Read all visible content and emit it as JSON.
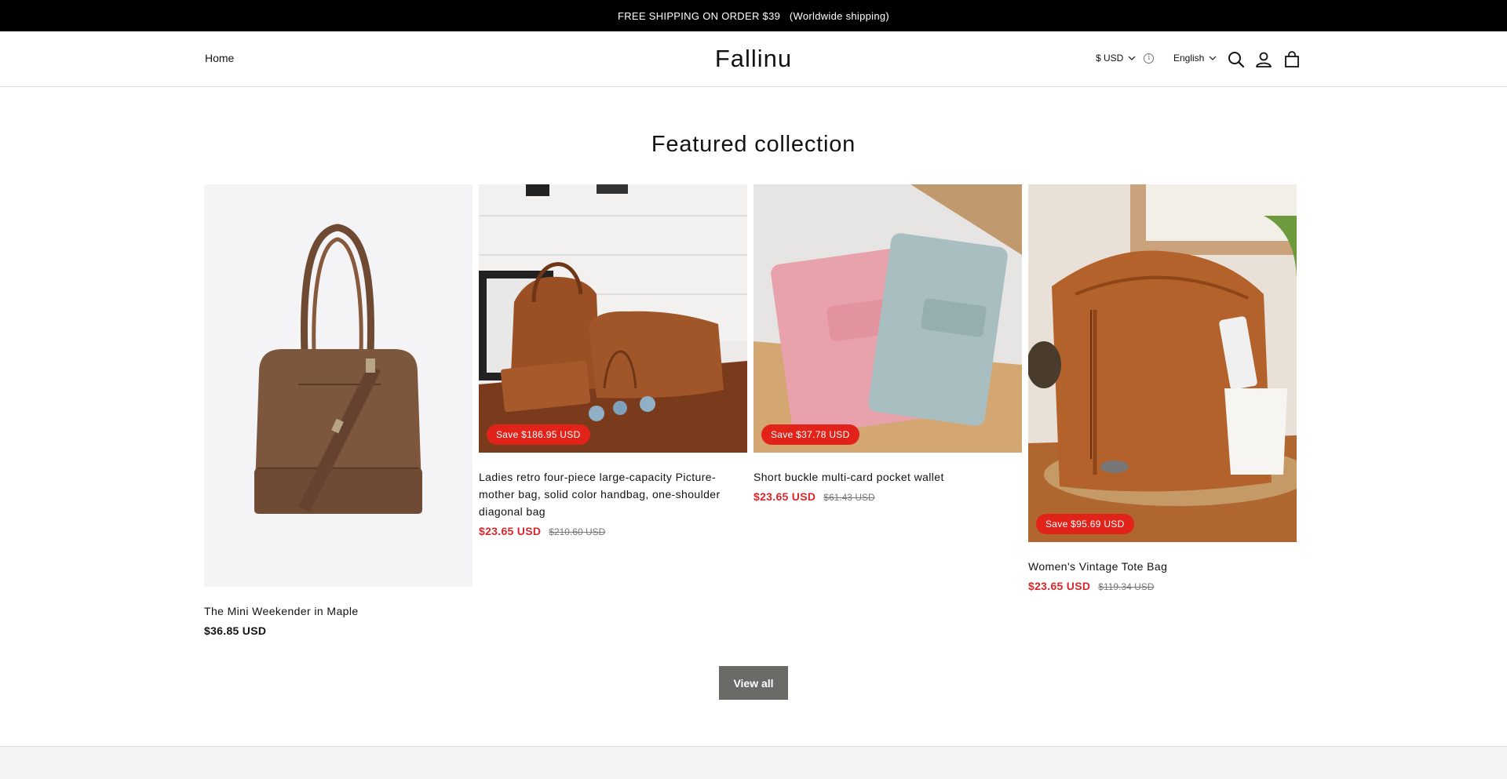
{
  "announcement": {
    "text": "FREE SHIPPING ON ORDER $39   (Worldwide shipping)"
  },
  "header": {
    "nav_home": "Home",
    "logo": "Fallinu",
    "currency": "$ USD",
    "language": "English",
    "icons": [
      "search-icon",
      "account-icon",
      "cart-icon",
      "info-icon",
      "chevron-down-icon"
    ]
  },
  "section": {
    "title": "Featured collection"
  },
  "products": [
    {
      "title": "The Mini Weekender in Maple",
      "price": "$36.85 USD",
      "badge": "",
      "compare_price": ""
    },
    {
      "title": "Ladies retro four-piece large-capacity Picture-mother bag, solid color handbag, one-shoulder diagonal bag",
      "price": "$23.65 USD",
      "compare_price": "$210.60 USD",
      "badge": "Save $186.95 USD"
    },
    {
      "title": "Short buckle multi-card pocket wallet",
      "price": "$23.65 USD",
      "compare_price": "$61.43 USD",
      "badge": "Save $37.78 USD"
    },
    {
      "title": "Women's Vintage Tote Bag",
      "price": "$23.65 USD",
      "compare_price": "$119.34 USD",
      "badge": "Save $95.69 USD"
    }
  ],
  "view_all": "View all",
  "colors": {
    "sale": "#d8262b",
    "badge": "#e2231a",
    "button": "#6b6a66",
    "announcement_bg": "#000000"
  }
}
